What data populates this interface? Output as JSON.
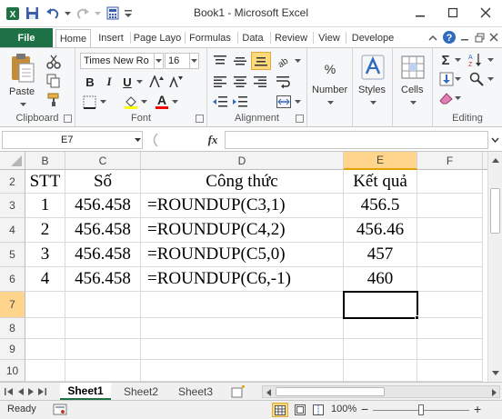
{
  "window": {
    "title": "Book1 - Microsoft Excel",
    "accent_color": "#1e7145"
  },
  "tabs": {
    "file": "File",
    "items": [
      "Home",
      "Insert",
      "Page Layo",
      "Formulas",
      "Data",
      "Review",
      "View",
      "Develope"
    ],
    "active": "Home"
  },
  "ribbon": {
    "clipboard": {
      "label": "Clipboard",
      "paste": "Paste"
    },
    "font": {
      "label": "Font",
      "family": "Times New Ro",
      "size": "16",
      "bold": "B",
      "italic": "I",
      "underline": "U",
      "font_color_glyph": "A"
    },
    "alignment": {
      "label": "Alignment"
    },
    "number": {
      "label": "Number",
      "glyph": "%"
    },
    "styles": {
      "label": "Styles"
    },
    "cells": {
      "label": "Cells"
    },
    "editing": {
      "label": "Editing",
      "sum_glyph": "Σ"
    }
  },
  "formula_bar": {
    "name_box": "E7",
    "fx": "fx",
    "value": ""
  },
  "sheet": {
    "columns": [
      "B",
      "C",
      "D",
      "E",
      "F"
    ],
    "selected_column": "E",
    "row_numbers": [
      "2",
      "3",
      "4",
      "5",
      "6",
      "7",
      "8",
      "9",
      "10"
    ],
    "selected_row": "7",
    "headers": {
      "stt": "STT",
      "so": "Số",
      "cong_thuc": "Công thức",
      "ket_qua": "Kết quả"
    },
    "rows": [
      {
        "stt": "1",
        "so": "456.458",
        "formula": "=ROUNDUP(C3,1)",
        "result": "456.5"
      },
      {
        "stt": "2",
        "so": "456.458",
        "formula": "=ROUNDUP(C4,2)",
        "result": "456.46"
      },
      {
        "stt": "3",
        "so": "456.458",
        "formula": "=ROUNDUP(C5,0)",
        "result": "457"
      },
      {
        "stt": "4",
        "so": "456.458",
        "formula": "=ROUNDUP(C6,-1)",
        "result": "460"
      }
    ]
  },
  "sheet_tabs": {
    "items": [
      "Sheet1",
      "Sheet2",
      "Sheet3"
    ],
    "active": "Sheet1"
  },
  "status": {
    "ready": "Ready",
    "zoom": "100%",
    "minus": "−",
    "plus": "+"
  }
}
